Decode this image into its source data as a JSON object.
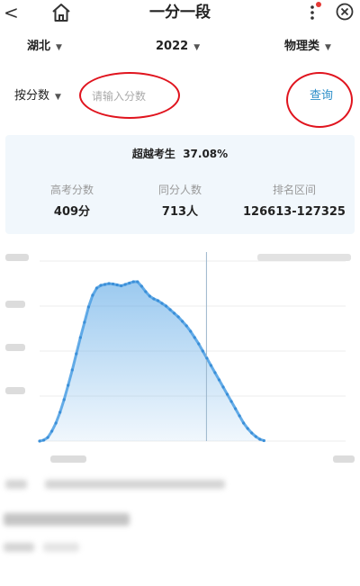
{
  "header": {
    "title": "一分一段",
    "back_glyph": "<"
  },
  "filters": {
    "province": "湖北",
    "year": "2022",
    "category": "物理类"
  },
  "search": {
    "mode": "按分数",
    "placeholder": "请输入分数",
    "query_label": "查询"
  },
  "stats": {
    "beat_label": "超越考生",
    "beat_value": "37.08%",
    "columns": [
      {
        "label": "高考分数",
        "value": "409分"
      },
      {
        "label": "同分人数",
        "value": "713人"
      },
      {
        "label": "排名区间",
        "value": "126613-127325"
      }
    ]
  },
  "colors": {
    "accent": "#2d8fc9",
    "highlight_ring": "#e0141e",
    "panel_bg": "#f1f7fc"
  },
  "icons": [
    "back-icon",
    "home-icon",
    "more-icon",
    "close-icon",
    "chevron-down-icon"
  ],
  "chart_data": {
    "type": "area",
    "title": "",
    "xlabel": "",
    "ylabel": "",
    "x": [
      0,
      10,
      20,
      30,
      40,
      50,
      60,
      70,
      80,
      90,
      100,
      110,
      120,
      130,
      140,
      150,
      160,
      170,
      180,
      190,
      200,
      210,
      220,
      230,
      240,
      250,
      260,
      270,
      280,
      290,
      300,
      310,
      320,
      330,
      340,
      350,
      360,
      370,
      380,
      390,
      400,
      410,
      420,
      430,
      440,
      450,
      460,
      470,
      480,
      490,
      500,
      510,
      520,
      530,
      540,
      550,
      560,
      570,
      580,
      590,
      600,
      610,
      620,
      630,
      640,
      650,
      660,
      670,
      680,
      690,
      700,
      710,
      720,
      730,
      740,
      750
    ],
    "values": [
      0,
      10,
      40,
      110,
      200,
      320,
      460,
      620,
      790,
      970,
      1150,
      1320,
      1490,
      1620,
      1700,
      1730,
      1740,
      1750,
      1745,
      1735,
      1725,
      1740,
      1755,
      1770,
      1770,
      1720,
      1660,
      1610,
      1580,
      1560,
      1530,
      1500,
      1460,
      1420,
      1380,
      1330,
      1280,
      1220,
      1150,
      1080,
      1000,
      920,
      840,
      760,
      680,
      600,
      520,
      440,
      360,
      280,
      200,
      140,
      90,
      50,
      20,
      5
    ],
    "ylim": [
      0,
      2000
    ],
    "grid": true,
    "marker_x": 409
  }
}
